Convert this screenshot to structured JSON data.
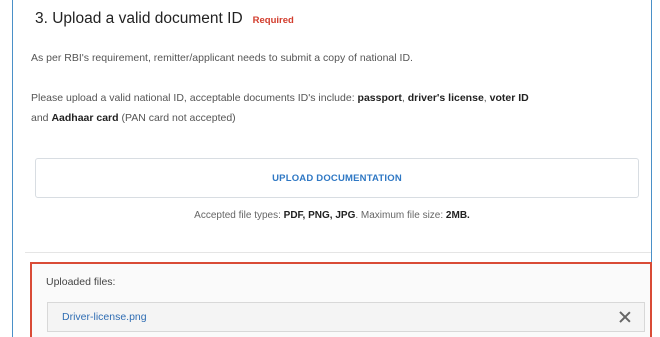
{
  "section": {
    "title": "3. Upload a valid document ID",
    "required_label": "Required"
  },
  "intro": {
    "line1": "As per RBI's requirement, remitter/applicant needs to submit a copy of national ID.",
    "line2_prefix": "Please upload a valid national ID, acceptable documents ID's include: ",
    "doc1": "passport",
    "sep1": ", ",
    "doc2": "driver's license",
    "sep2": ", ",
    "doc3": "voter ID",
    "line3_prefix": "and ",
    "doc4": "Aadhaar card",
    "note": " (PAN card not accepted)"
  },
  "upload": {
    "button_label": "UPLOAD DOCUMENTATION",
    "types_prefix": "Accepted file types: ",
    "types": "PDF, PNG, JPG",
    "size_prefix": ". Maximum file size: ",
    "max_size": "2MB."
  },
  "uploaded": {
    "label": "Uploaded files:",
    "files": [
      {
        "name": "Driver-license.png"
      }
    ]
  }
}
